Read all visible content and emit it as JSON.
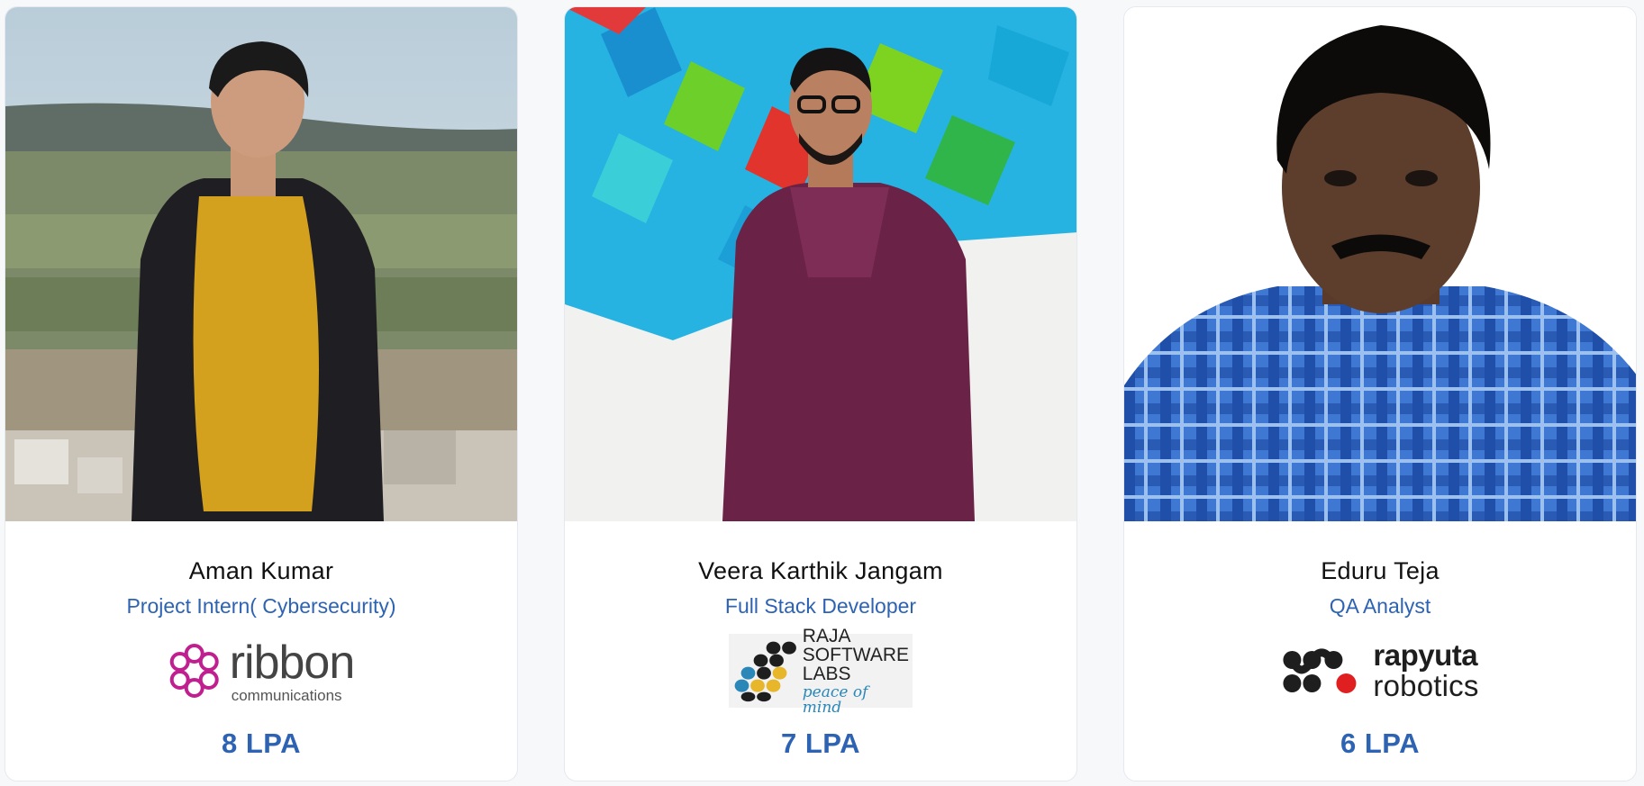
{
  "cards": [
    {
      "name": "Aman Kumar",
      "role": "Project Intern( Cybersecurity)",
      "company_logo": {
        "word": "ribbon",
        "sub": "communications",
        "icon": "ribbon-circle-icon",
        "color": "#c0208f"
      },
      "package": "8 LPA"
    },
    {
      "name": "Veera Karthik Jangam",
      "role": "Full Stack Developer",
      "company_logo": {
        "lines": [
          "RAJA",
          "SOFTWARE",
          "LABS"
        ],
        "tagline": "peace of mind",
        "icon": "dot-grid-icon"
      },
      "package": "7 LPA"
    },
    {
      "name": "Eduru Teja",
      "role": "QA Analyst",
      "company_logo": {
        "word": "rapyuta",
        "sub": "robotics",
        "icon": "rapyuta-icon",
        "accent": "#e02020"
      },
      "package": "6 LPA"
    }
  ],
  "colors": {
    "accent": "#2d63b2",
    "name_text": "#111111",
    "card_bg": "#ffffff",
    "page_bg": "#f7f8fa"
  }
}
